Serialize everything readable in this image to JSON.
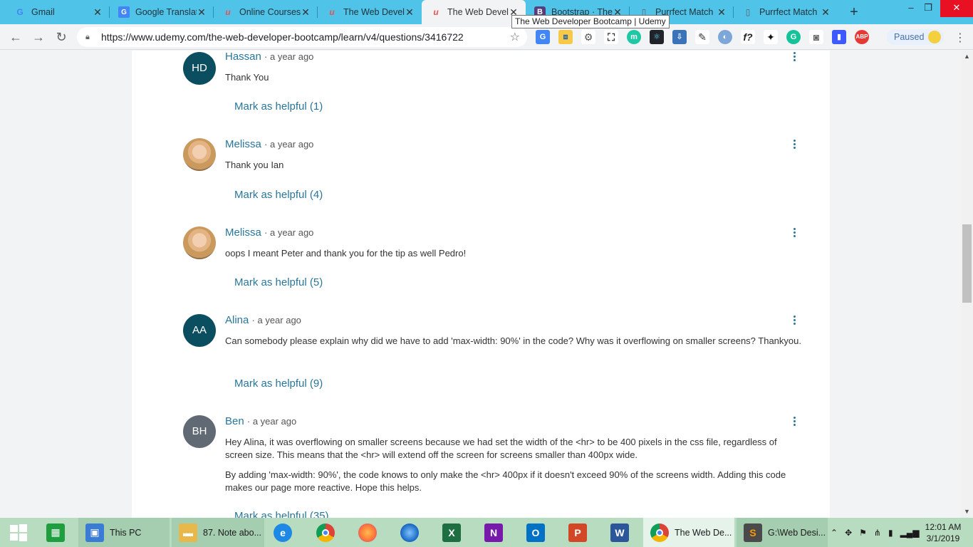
{
  "browser": {
    "tabs": [
      {
        "label": "Gmail",
        "icon": "G",
        "icon_color": "#4285f4"
      },
      {
        "label": "Google Translat",
        "icon": "G",
        "icon_color": "#4285f4"
      },
      {
        "label": "Online Courses",
        "icon": "u",
        "icon_color": "#ec5252"
      },
      {
        "label": "The Web Devel",
        "icon": "u",
        "icon_color": "#ec5252"
      },
      {
        "label": "The Web Devel",
        "icon": "u",
        "icon_color": "#ec5252"
      },
      {
        "label": "Bootstrap · The",
        "icon": "B",
        "icon_color": "#563d7c"
      },
      {
        "label": "Purrfect Match",
        "icon": "□",
        "icon_color": "#5f6368"
      },
      {
        "label": "Purrfect Match",
        "icon": "□",
        "icon_color": "#5f6368"
      }
    ],
    "tooltip": "The Web Developer Bootcamp | Udemy",
    "url": "https://www.udemy.com/the-web-developer-bootcamp/learn/v4/questions/3416722",
    "profile_status": "Paused"
  },
  "comments": [
    {
      "initials": "HD",
      "name": "Hassan",
      "time": "· a year ago",
      "body": [
        "Thank You"
      ],
      "helpful": "Mark as helpful (1)"
    },
    {
      "initials": "",
      "name": "Melissa",
      "time": "· a year ago",
      "body": [
        "Thank you Ian"
      ],
      "helpful": "Mark as helpful (4)"
    },
    {
      "initials": "",
      "name": "Melissa",
      "time": "· a year ago",
      "body": [
        "oops I meant Peter and thank you for the tip as well Pedro!"
      ],
      "helpful": "Mark as helpful (5)"
    },
    {
      "initials": "AA",
      "name": "Alina",
      "time": "· a year ago",
      "body": [
        "Can somebody please explain why did we have to add 'max-width: 90%' in the code? Why was it overflowing on smaller screens? Thankyou."
      ],
      "helpful": "Mark as helpful (9)"
    },
    {
      "initials": "BH",
      "name": "Ben",
      "time": "· a year ago",
      "body": [
        "Hey Alina, it was overflowing on smaller screens because we had set the width of the <hr> to be 400 pixels in the css file, regardless of screen size. This means that the <hr> will extend off the screen for screens smaller than 400px wide.",
        "By adding 'max-width: 90%', the code knows to only make the <hr> 400px if it doesn't exceed 90% of the screens width. Adding this code makes our page more reactive. Hope this helps."
      ],
      "helpful": "Mark as helpful (35)"
    }
  ],
  "taskbar": {
    "items": [
      {
        "label": "This PC",
        "icon": "▣",
        "color": "#3a7bd5"
      },
      {
        "label": "87. Note abo...",
        "icon": "▬",
        "color": "#e8b84a"
      },
      {
        "label": "",
        "icon": "e",
        "color": "#1e88e5"
      },
      {
        "label": "",
        "icon": "●",
        "color": "#db4437"
      },
      {
        "label": "",
        "icon": "●",
        "color": "#ff7139"
      },
      {
        "label": "",
        "icon": "●",
        "color": "#1565c0"
      },
      {
        "label": "",
        "icon": "X",
        "color": "#1d6f42"
      },
      {
        "label": "",
        "icon": "N",
        "color": "#7719aa"
      },
      {
        "label": "",
        "icon": "O",
        "color": "#0072c6"
      },
      {
        "label": "",
        "icon": "P",
        "color": "#d24726"
      },
      {
        "label": "",
        "icon": "W",
        "color": "#2b579a"
      },
      {
        "label": "The Web De...",
        "icon": "●",
        "color": "#db4437"
      },
      {
        "label": "G:\\Web Desi...",
        "icon": "S",
        "color": "#ff9800"
      }
    ],
    "time": "12:01 AM",
    "date": "3/1/2019"
  }
}
